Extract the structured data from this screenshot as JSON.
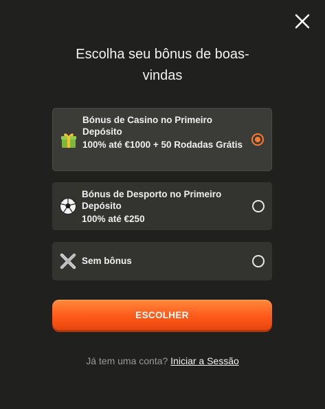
{
  "dialog": {
    "title": "Escolha seu bônus de boas-vindas"
  },
  "options": [
    {
      "title": "Bónus de Casino no Primeiro Depósito",
      "subtitle": "100% até €1000 + 50 Rodadas Grátis",
      "icon": "gift-icon",
      "selected": true
    },
    {
      "title": "Bónus de Desporto no Primeiro Depósito",
      "subtitle": "100% até €250",
      "icon": "soccer-ball-icon",
      "selected": false
    },
    {
      "title": "Sem bônus",
      "subtitle": "",
      "icon": "no-bonus-icon",
      "selected": false
    }
  ],
  "cta": {
    "label": "ESCOLHER"
  },
  "footer": {
    "question": "Já tem uma conta?",
    "link": "Iniciar a Sessão"
  },
  "colors": {
    "background": "#20201e",
    "card": "#33332f",
    "accent": "#ff6a24"
  }
}
